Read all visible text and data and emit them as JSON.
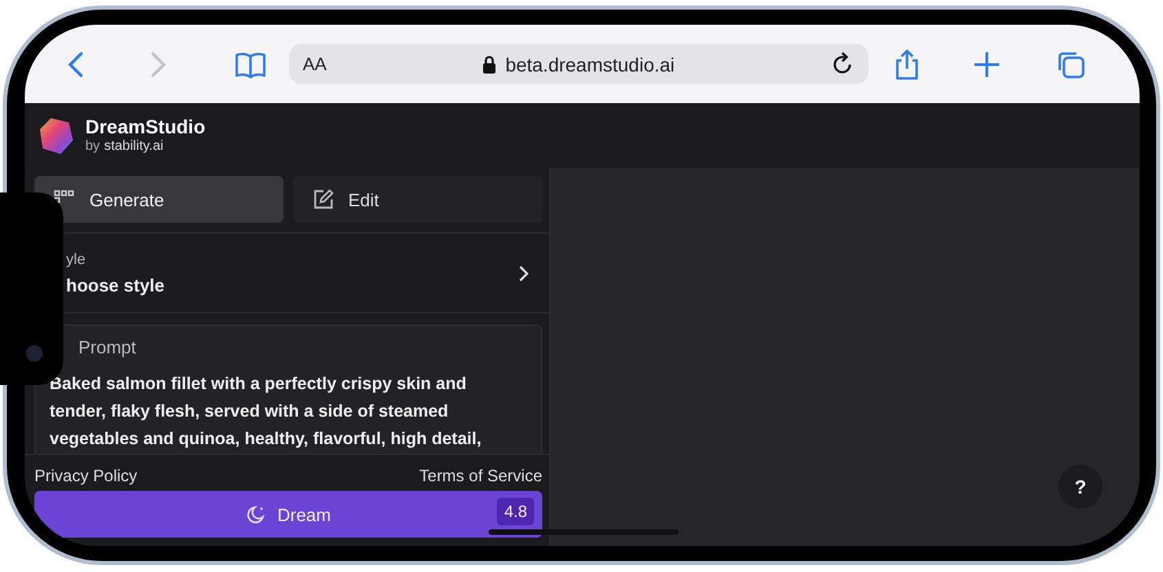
{
  "browser": {
    "text_size": "AA",
    "url": "beta.dreamstudio.ai"
  },
  "app": {
    "name": "DreamStudio",
    "by": "by",
    "brand": "stability.ai"
  },
  "tabs": [
    {
      "label": "Generate",
      "kind": "generate",
      "selected": true
    },
    {
      "label": "Edit",
      "kind": "edit",
      "selected": false
    }
  ],
  "style": {
    "label": "yle",
    "value": "hoose style"
  },
  "prompt": {
    "label": "Prompt",
    "text": "Baked salmon fillet with a perfectly crispy skin and tender, flaky flesh, served with a side of steamed vegetables and quinoa, healthy, flavorful, high detail,"
  },
  "footer_links": [
    "Privacy Policy",
    "Terms of Service"
  ],
  "dream_button": {
    "label": "Dream",
    "cost": "4.8"
  },
  "help_button": "?"
}
